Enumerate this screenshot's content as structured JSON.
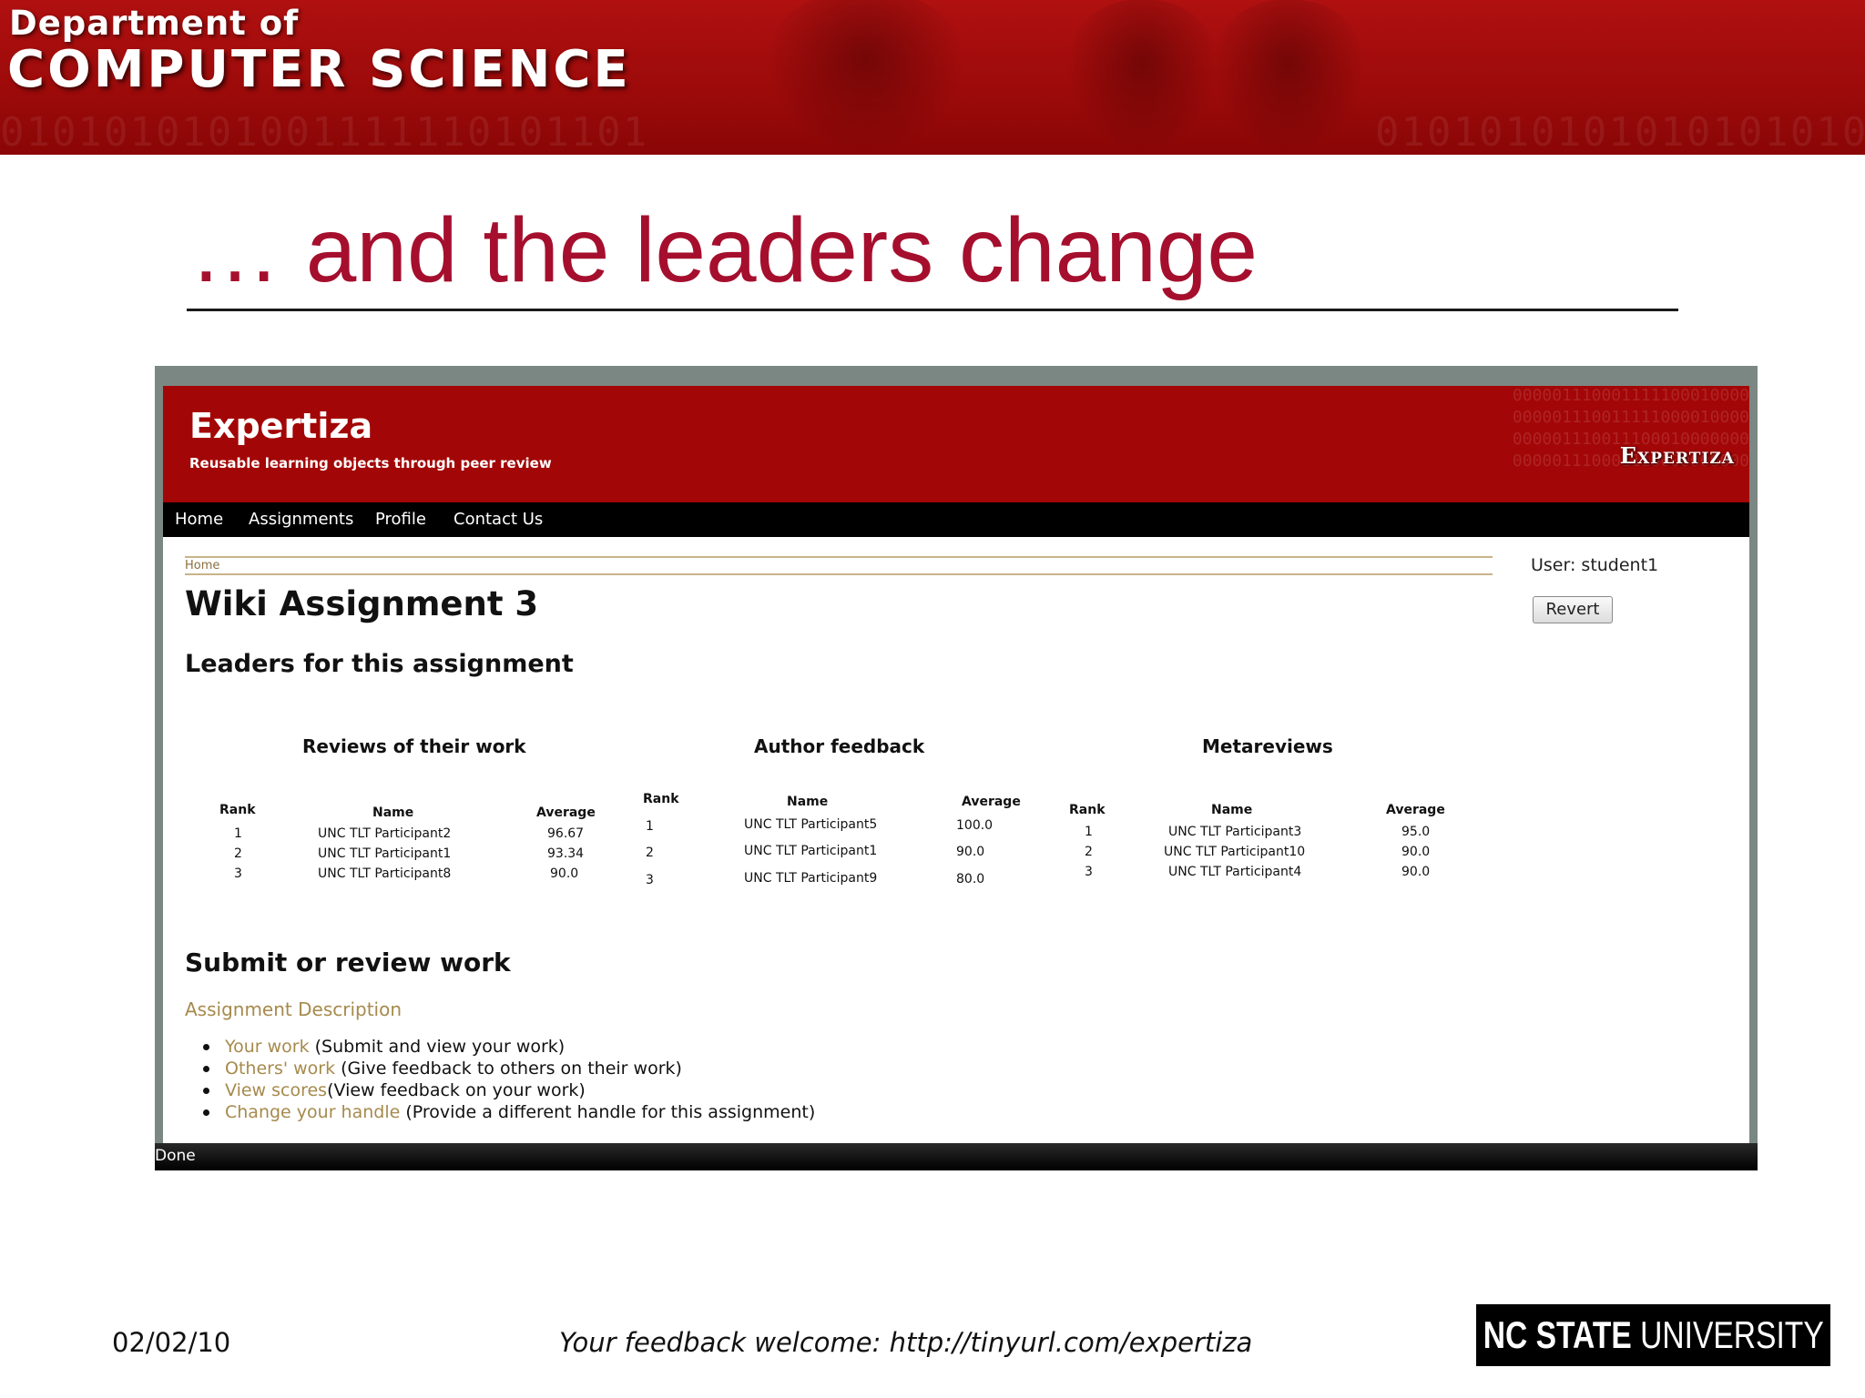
{
  "dept_banner": {
    "line1": "Department of",
    "line2": "COMPUTER SCIENCE"
  },
  "slide": {
    "title": "… and the leaders change"
  },
  "app": {
    "logo": "Expertiza",
    "tagline": "Reusable learning objects through peer review",
    "badge": "Expertiza",
    "nav": [
      "Home",
      "Assignments",
      "Profile",
      "Contact Us"
    ],
    "breadcrumb": "Home",
    "user_label": "User: student1",
    "revert_label": "Revert",
    "assignment_title": "Wiki Assignment 3",
    "leaders_heading": "Leaders for this assignment",
    "status_text": "Done"
  },
  "leaderboards": [
    {
      "title": "Reviews of their work",
      "headers": {
        "rank": "Rank",
        "name": "Name",
        "average": "Average"
      },
      "rows": [
        {
          "rank": "1",
          "name": "UNC TLT Participant2",
          "average": "96.67"
        },
        {
          "rank": "2",
          "name": "UNC TLT Participant1",
          "average": "93.34"
        },
        {
          "rank": "3",
          "name": "UNC TLT Participant8",
          "average": "90.0"
        }
      ]
    },
    {
      "title": "Author feedback",
      "headers": {
        "rank": "Rank",
        "name": "Name",
        "average": "Average"
      },
      "rows": [
        {
          "rank": "1",
          "name": "UNC TLT Participant5",
          "average": "100.0"
        },
        {
          "rank": "2",
          "name": "UNC TLT Participant1",
          "average": "90.0"
        },
        {
          "rank": "3",
          "name": "UNC TLT Participant9",
          "average": "80.0"
        }
      ]
    },
    {
      "title": "Metareviews",
      "headers": {
        "rank": "Rank",
        "name": "Name",
        "average": "Average"
      },
      "rows": [
        {
          "rank": "1",
          "name": "UNC TLT Participant3",
          "average": "95.0"
        },
        {
          "rank": "2",
          "name": "UNC TLT Participant10",
          "average": "90.0"
        },
        {
          "rank": "3",
          "name": "UNC TLT Participant4",
          "average": "90.0"
        }
      ]
    }
  ],
  "submit_section": {
    "heading": "Submit or review work",
    "description_link": "Assignment Description",
    "items": [
      {
        "link": "Your work",
        "text": " (Submit and view your work)"
      },
      {
        "link": "Others' work",
        "text": " (Give feedback to others on their work)"
      },
      {
        "link": "View scores",
        "text": "(View feedback on your work)"
      },
      {
        "link": "Change your handle",
        "text": " (Provide a different handle for this assignment)"
      }
    ]
  },
  "footer": {
    "date": "02/02/10",
    "feedback": "Your feedback welcome: http://tinyurl.com/expertiza",
    "logo_bold": "NC STATE",
    "logo_thin": " UNIVERSITY"
  },
  "colors": {
    "banner_red": "#9c0a0a",
    "title_red": "#a50f2d",
    "app_red": "#a30606",
    "link_gold": "#a68a4c"
  }
}
